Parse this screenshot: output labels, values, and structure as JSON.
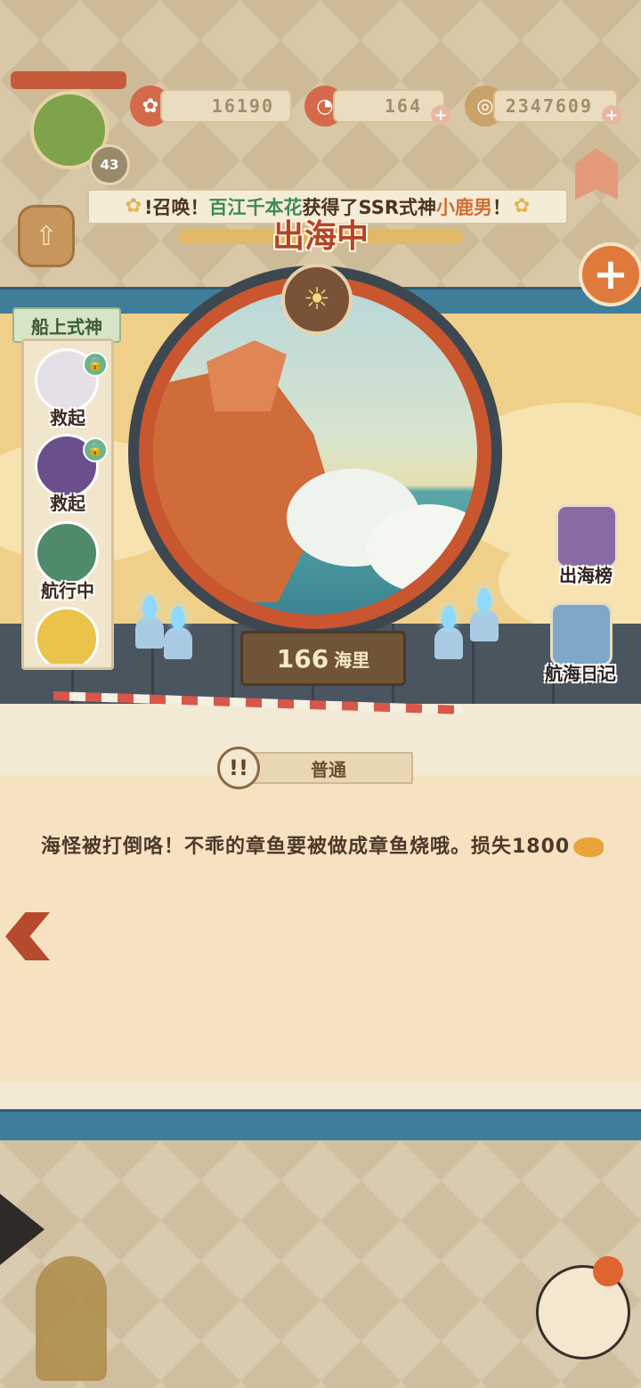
{
  "resources": {
    "currency1": "16190",
    "currency2": "164",
    "currency3": "2347609",
    "plus": "+"
  },
  "player": {
    "level": "43"
  },
  "banner": {
    "prefix": "!召唤！",
    "player_name": "百江千本花",
    "middle": "获得了SSR式神",
    "shikigami": "小鹿男",
    "suffix": "！"
  },
  "title": "出海中",
  "close": "+",
  "sidebar": {
    "title": "船上式神",
    "items": [
      {
        "label": "救起",
        "locked": true
      },
      {
        "label": "救起",
        "locked": true
      },
      {
        "label": "航行中",
        "locked": false
      },
      {
        "label": "",
        "locked": false
      }
    ]
  },
  "distance": {
    "value": "166",
    "unit": "海里"
  },
  "right_buttons": [
    {
      "label": "出海榜"
    },
    {
      "label": "航海日记"
    }
  ],
  "event": {
    "type": "普通",
    "badge": "!!",
    "message": "海怪被打倒咯！不乖的章鱼要被做成章鱼烧哦。损失1800"
  },
  "colors": {
    "accent_red": "#c9562f",
    "sea_blue": "#3f7e9b",
    "paper": "#f6e2c0"
  }
}
